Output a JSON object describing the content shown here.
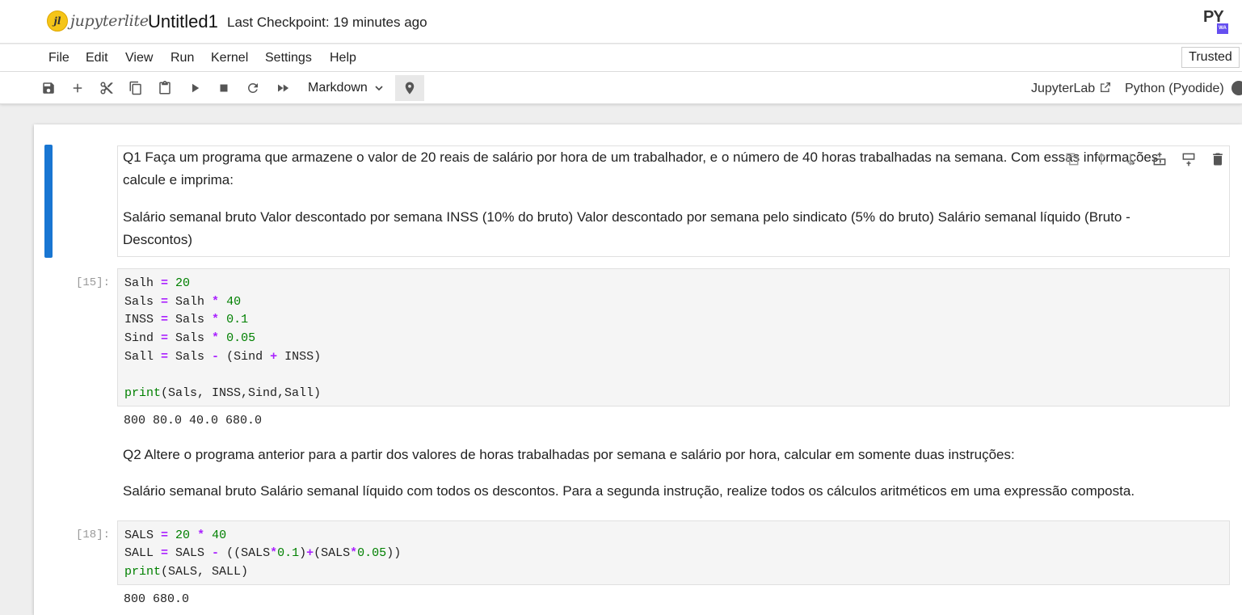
{
  "header": {
    "logo_text": "jupyterlite",
    "logo_ball": "jl",
    "notebook_title": "Untitled1",
    "checkpoint": "Last Checkpoint: 19 minutes ago",
    "badge_top": "PY",
    "badge_bottom": "WA"
  },
  "menu": {
    "items": [
      "File",
      "Edit",
      "View",
      "Run",
      "Kernel",
      "Settings",
      "Help"
    ],
    "trusted": "Trusted"
  },
  "toolbar": {
    "cell_type": "Markdown",
    "jupyterlab_link": "JupyterLab",
    "kernel": "Python (Pyodide)",
    "icons": [
      "save-icon",
      "add-icon",
      "cut-icon",
      "copy-icon",
      "paste-icon",
      "run-icon",
      "stop-icon",
      "restart-icon",
      "fast-forward-icon",
      "chevron-down-icon",
      "pin-icon",
      "external-link-icon",
      "kernel-status-icon"
    ]
  },
  "cells": {
    "md1": {
      "line1": "Q1 Faça um programa que armazene o valor de 20 reais de salário por hora de um trabalhador, e o número de 40 horas trabalhadas na semana. Com essas informações,",
      "line2": "calcule e imprima:",
      "line3": "Salário semanal bruto Valor descontado por semana INSS (10% do bruto) Valor descontado por semana pelo sindicato (5% do bruto) Salário semanal líquido (Bruto -",
      "line4": "Descontos)"
    },
    "code1": {
      "prompt": "[15]:",
      "output": "800 80.0 40.0 680.0"
    },
    "md2": {
      "line1": "Q2 Altere o programa anterior para a partir dos valores de horas trabalhadas por semana e salário por hora, calcular em somente duas instruções:",
      "line2": "Salário semanal bruto Salário semanal líquido com todos os descontos. Para a segunda instrução, realize todos os cálculos aritméticos em uma expressão composta."
    },
    "code2": {
      "prompt": "[18]:",
      "output": "800 680.0"
    }
  },
  "colors": {
    "active_cell": "#1976d2",
    "operator": "#aa22ff",
    "number": "#008000"
  }
}
